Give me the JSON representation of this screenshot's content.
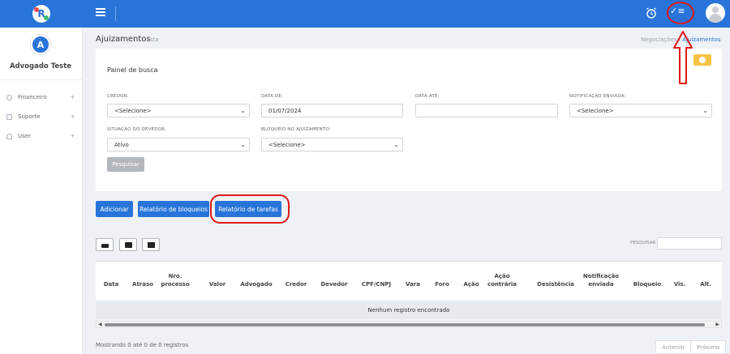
{
  "topbar": {
    "logo_letter": "R",
    "icons": [
      "menu-icon",
      "alarm-icon",
      "tasks-icon",
      "user-icon"
    ],
    "tasks_glyph": "✓≡"
  },
  "sidebar": {
    "avatar_letter": "A",
    "user_name": "Advogado Teste",
    "items": [
      {
        "label": "Financeiro",
        "icon": "money-icon"
      },
      {
        "label": "Suporte",
        "icon": "chat-icon"
      },
      {
        "label": "User",
        "icon": "user-icon"
      }
    ],
    "expand_glyph": "+"
  },
  "header": {
    "title": "Ajuizamentos",
    "subtitle": "lista",
    "breadcrumb": [
      "Negociações",
      "Ajuizamentos"
    ],
    "breadcrumb_sep": "/"
  },
  "search_panel": {
    "title": "Painel de busca",
    "fields": {
      "credor": {
        "label": "CREDOR:",
        "value": "<Selecione>"
      },
      "data_de": {
        "label": "DATA DE:",
        "value": "01/07/2024"
      },
      "data_ate": {
        "label": "DATA ATÉ:",
        "value": ""
      },
      "notificacao": {
        "label": "NOTIFICAÇÃO ENVIADA:",
        "value": "<Selecione>"
      },
      "situacao": {
        "label": "SITUAÇÃO DO DEVEDOR:",
        "value": "Ativo"
      },
      "bloqueio": {
        "label": "BLOQUEIO NO AJUIZAMENTO:",
        "value": "<Selecione>"
      }
    },
    "search_button": "Pesquisar"
  },
  "actions": {
    "add": "Adicionar",
    "blocks_report": "Relatório de bloqueios",
    "tasks_report": "Relatório de tarefas"
  },
  "table": {
    "tool_icons": [
      "print-icon",
      "archive-icon",
      "image-export-icon"
    ],
    "search_label": "PESQUISAR",
    "columns": [
      {
        "l1": "",
        "l2": "Data"
      },
      {
        "l1": "",
        "l2": "Atraso"
      },
      {
        "l1": "Nro.",
        "l2": "processo"
      },
      {
        "l1": "",
        "l2": "Valor"
      },
      {
        "l1": "",
        "l2": "Advogado"
      },
      {
        "l1": "",
        "l2": "Credor"
      },
      {
        "l1": "",
        "l2": "Devedor"
      },
      {
        "l1": "",
        "l2": "CPF/CNPJ"
      },
      {
        "l1": "",
        "l2": "Vara"
      },
      {
        "l1": "",
        "l2": "Foro"
      },
      {
        "l1": "",
        "l2": "Ação"
      },
      {
        "l1": "Ação",
        "l2": "contrária"
      },
      {
        "l1": "",
        "l2": "Desistência"
      },
      {
        "l1": "Notificação",
        "l2": "enviada"
      },
      {
        "l1": "",
        "l2": "Bloqueio"
      },
      {
        "l1": "",
        "l2": "Vis."
      },
      {
        "l1": "",
        "l2": "Alt."
      }
    ],
    "empty_message": "Nenhum registro encontrado",
    "info": "Mostrando 0 até 0 de 0 registros",
    "pager": {
      "prev": "Anterior",
      "next": "Próximo"
    }
  },
  "annotation_color": "#e01919",
  "accent_color": "#2874d9"
}
